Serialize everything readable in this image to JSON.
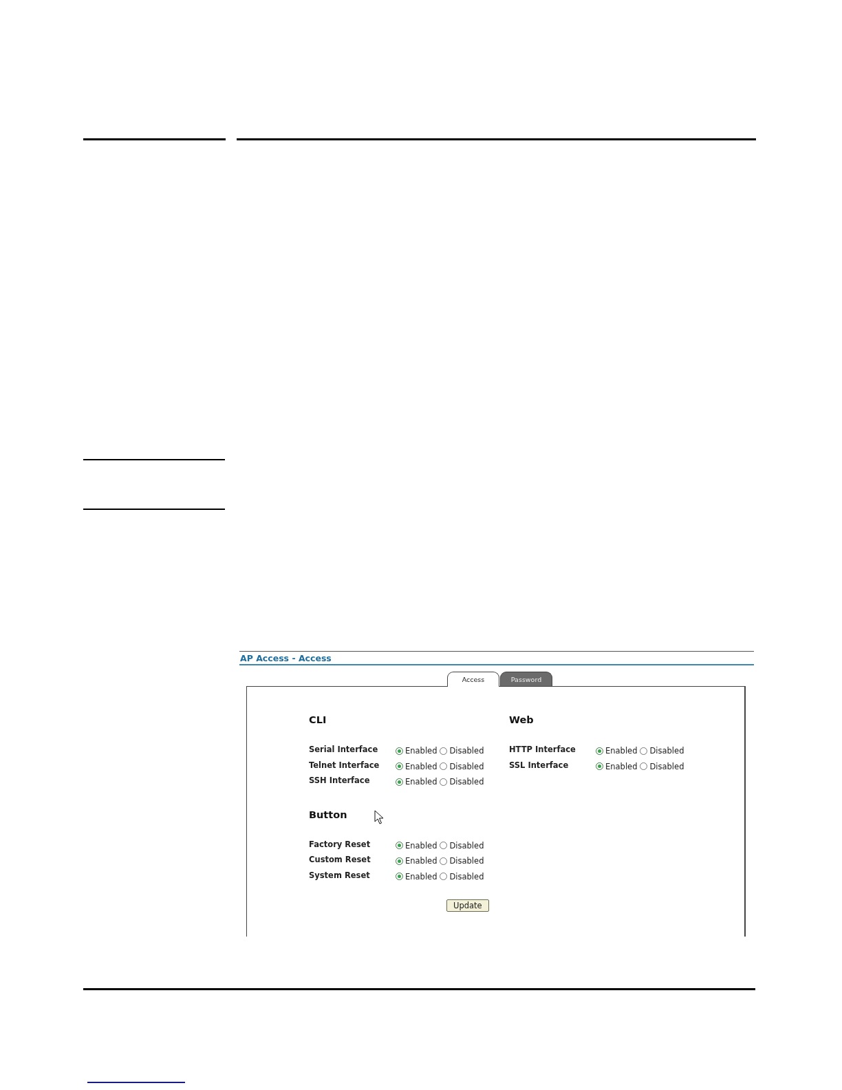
{
  "window": {
    "title": "AP Access - Access"
  },
  "tabs": [
    {
      "label": "Access",
      "selected": true
    },
    {
      "label": "Password",
      "selected": false
    }
  ],
  "columns": [
    {
      "groups": [
        {
          "heading": "CLI",
          "rows": [
            {
              "label": "Serial Interface",
              "options": [
                {
                  "label": "Enabled",
                  "selected": true
                },
                {
                  "label": "Disabled",
                  "selected": false
                }
              ]
            },
            {
              "label": "Telnet Interface",
              "options": [
                {
                  "label": "Enabled",
                  "selected": true
                },
                {
                  "label": "Disabled",
                  "selected": false
                }
              ]
            },
            {
              "label": "SSH Interface",
              "options": [
                {
                  "label": "Enabled",
                  "selected": true
                },
                {
                  "label": "Disabled",
                  "selected": false
                }
              ]
            }
          ]
        },
        {
          "heading": "Button",
          "rows": [
            {
              "label": "Factory Reset",
              "options": [
                {
                  "label": "Enabled",
                  "selected": true
                },
                {
                  "label": "Disabled",
                  "selected": false
                }
              ]
            },
            {
              "label": "Custom Reset",
              "options": [
                {
                  "label": "Enabled",
                  "selected": true
                },
                {
                  "label": "Disabled",
                  "selected": false
                }
              ]
            },
            {
              "label": "System Reset",
              "options": [
                {
                  "label": "Enabled",
                  "selected": true
                },
                {
                  "label": "Disabled",
                  "selected": false
                }
              ]
            }
          ]
        }
      ]
    },
    {
      "groups": [
        {
          "heading": "Web",
          "rows": [
            {
              "label": "HTTP Interface",
              "options": [
                {
                  "label": "Enabled",
                  "selected": true
                },
                {
                  "label": "Disabled",
                  "selected": false
                }
              ]
            },
            {
              "label": "SSL Interface",
              "options": [
                {
                  "label": "Enabled",
                  "selected": true
                },
                {
                  "label": "Disabled",
                  "selected": false
                }
              ]
            }
          ]
        }
      ]
    }
  ],
  "update_button": "Update"
}
